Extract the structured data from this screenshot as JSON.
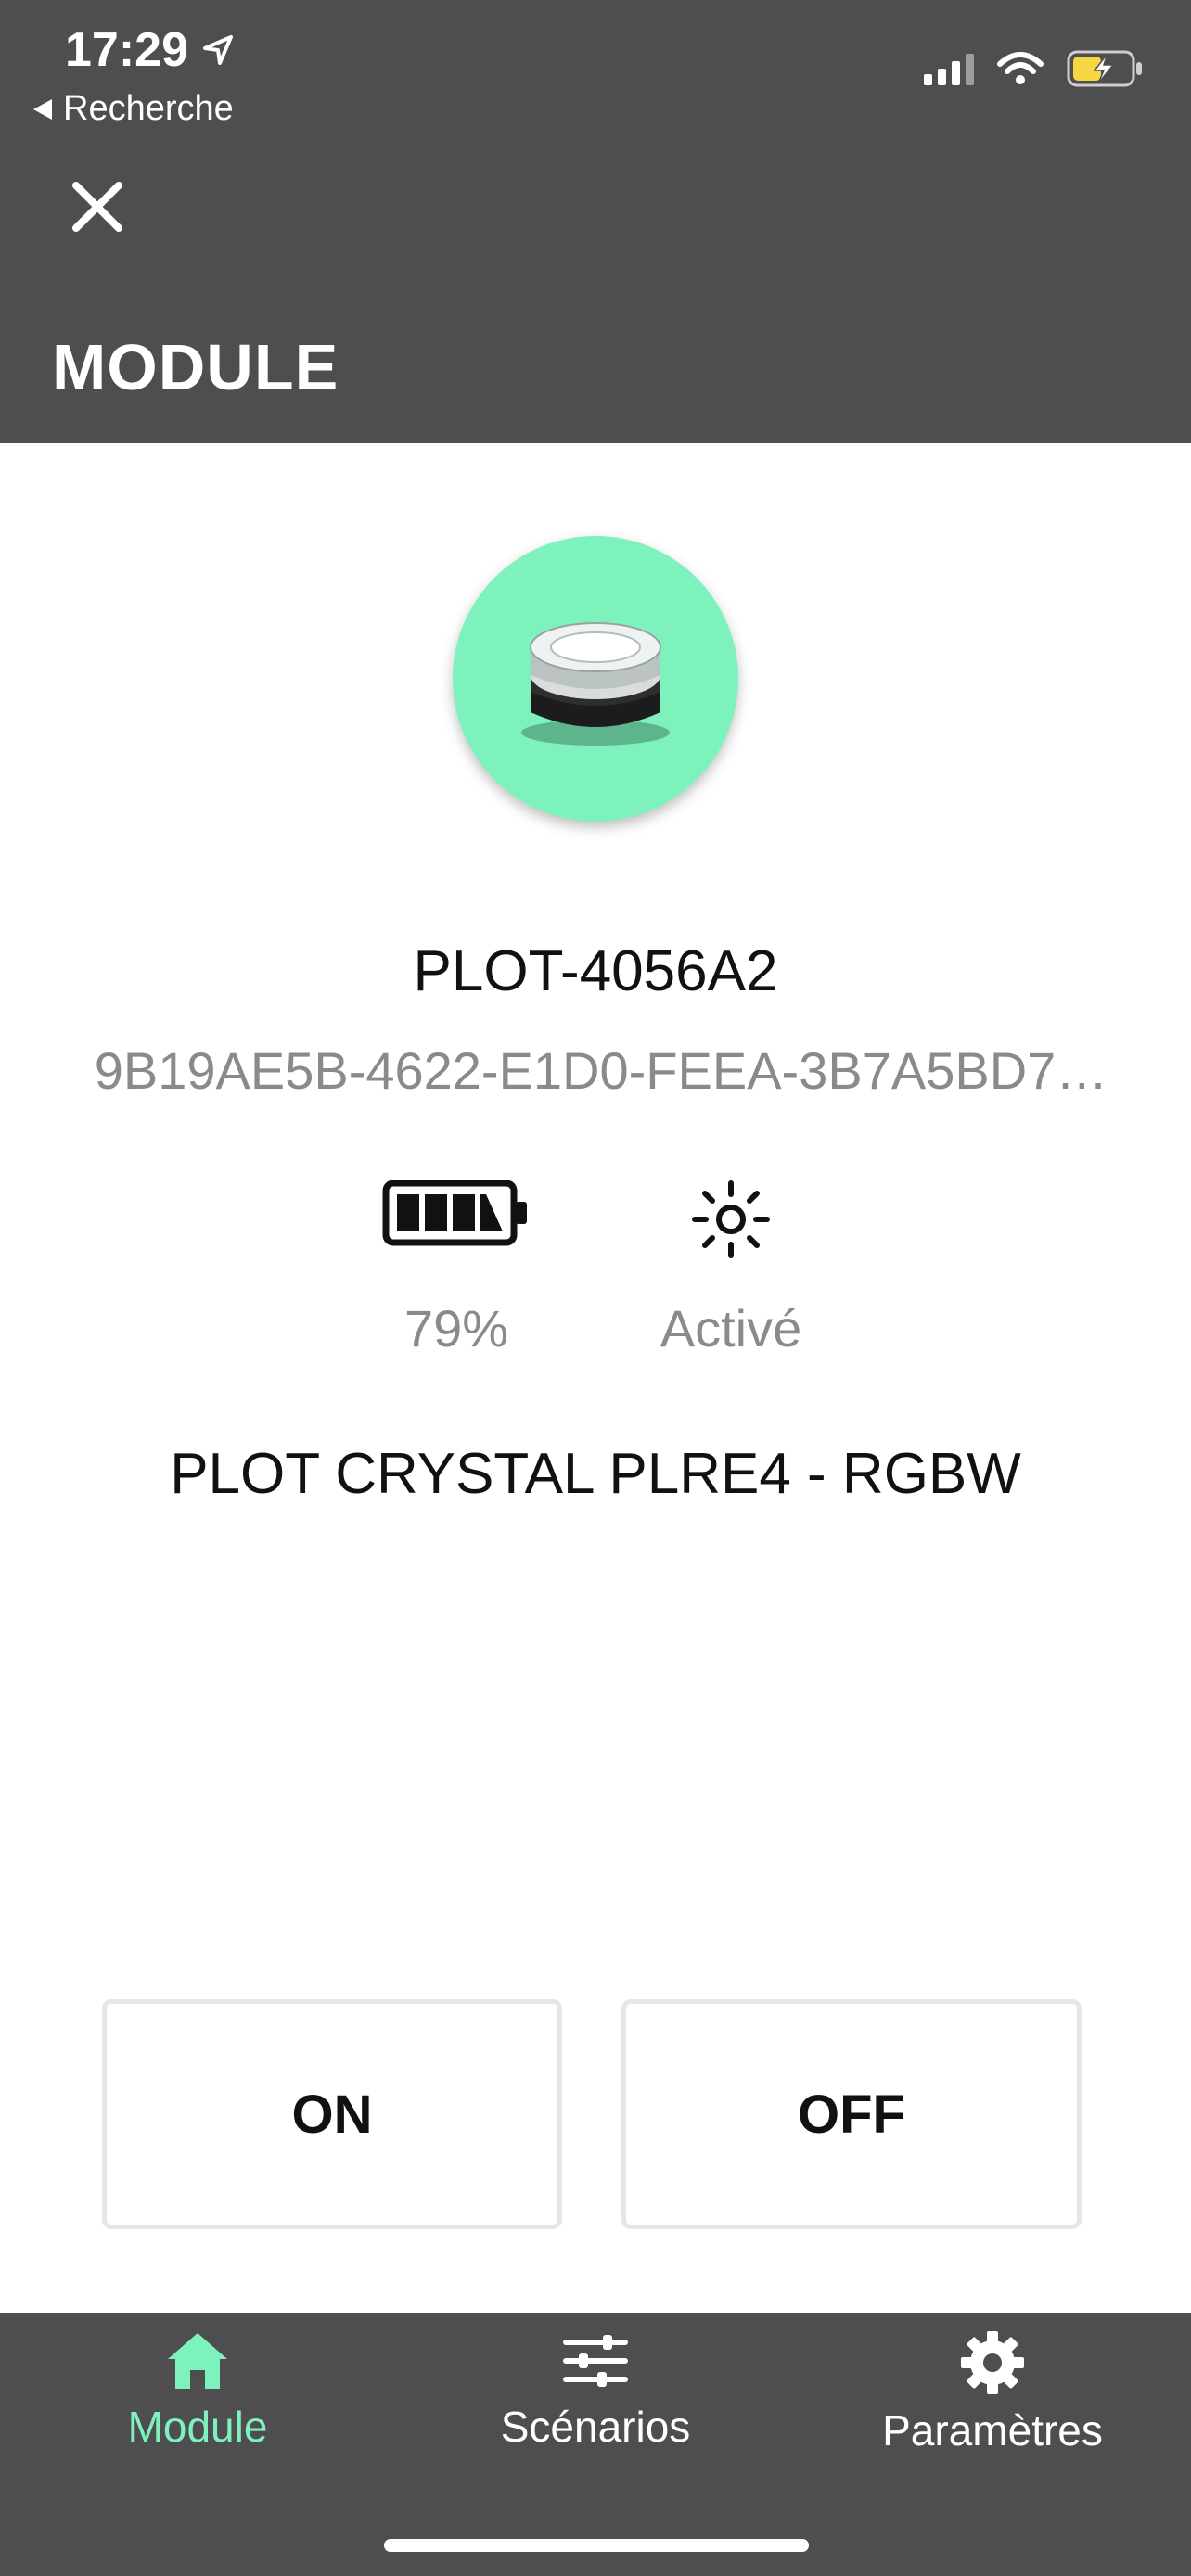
{
  "status_bar": {
    "time": "17:29",
    "back_label": "Recherche"
  },
  "header": {
    "title": "MODULE",
    "close_icon": "close-icon"
  },
  "device": {
    "name": "PLOT-4056A2",
    "uuid": "9B19AE5B-4622-E1D0-FEEA-3B7A5BD7…",
    "battery_label": "79%",
    "battery_level": 0.79,
    "light_label": "Activé",
    "model": "PLOT CRYSTAL PLRE4 - RGBW"
  },
  "actions": {
    "on_label": "ON",
    "off_label": "OFF"
  },
  "tabbar": {
    "tabs": [
      {
        "label": "Module",
        "icon": "home-icon",
        "active": true
      },
      {
        "label": "Scénarios",
        "icon": "sliders-icon",
        "active": false
      },
      {
        "label": "Paramètres",
        "icon": "gear-icon",
        "active": false
      }
    ]
  },
  "colors": {
    "header_bg": "#4e4e50",
    "accent": "#7ef2bd",
    "muted_text": "#8a8a8a",
    "battery_charging": "#f5d742"
  }
}
